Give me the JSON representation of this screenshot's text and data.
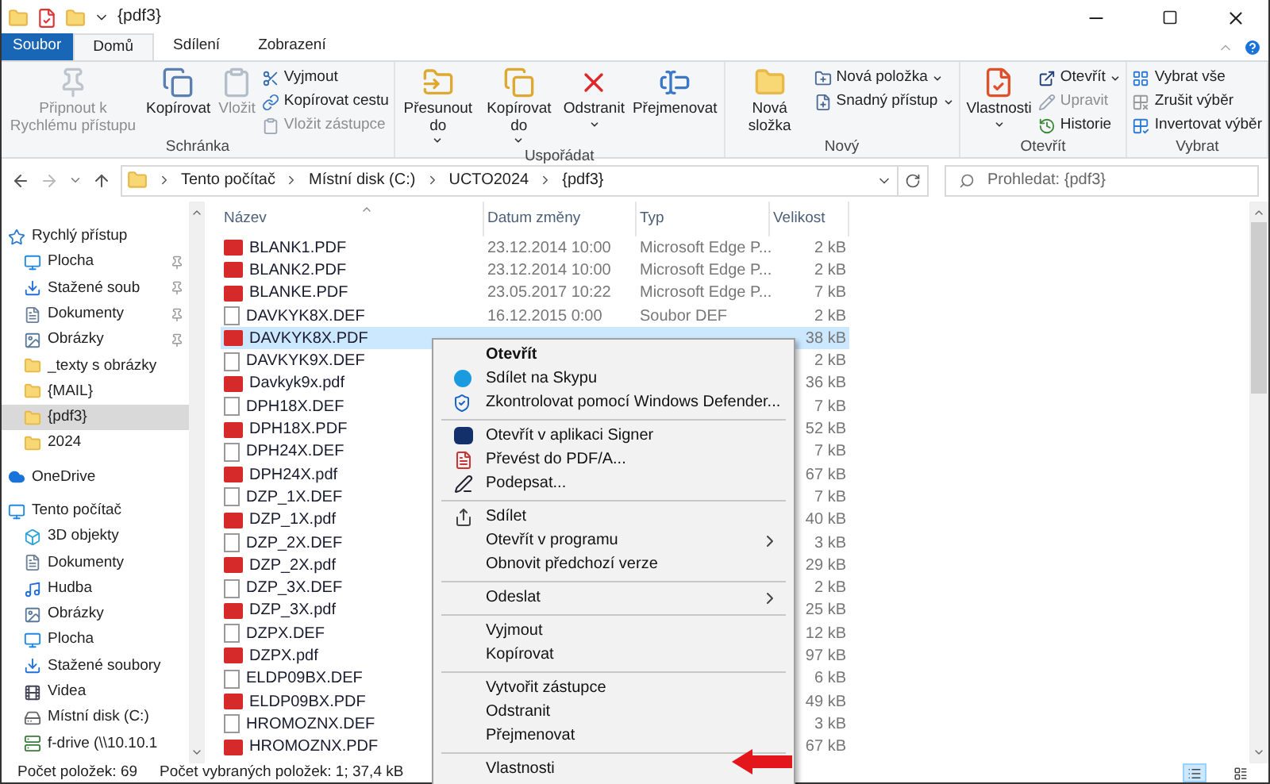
{
  "window": {
    "title": "{pdf3}"
  },
  "tabs": [
    {
      "label": "Soubor",
      "kind": "file",
      "selected": false
    },
    {
      "label": "Domů",
      "kind": "tab",
      "selected": true
    },
    {
      "label": "Sdílení",
      "kind": "tab",
      "selected": false
    },
    {
      "label": "Zobrazení",
      "kind": "tab",
      "selected": false
    }
  ],
  "ribbon": [
    {
      "label": "Schránka",
      "large": [
        {
          "label": "Připnout k Rychlému přístupu",
          "disabled": true,
          "dropdown": false
        },
        {
          "label": "Kopírovat",
          "disabled": false,
          "dropdown": false
        },
        {
          "label": "Vložit",
          "disabled": true,
          "dropdown": false
        }
      ],
      "small": [
        {
          "label": "Vyjmout",
          "disabled": false,
          "dropdown": false
        },
        {
          "label": "Kopírovat cestu",
          "disabled": false,
          "dropdown": false
        },
        {
          "label": "Vložit zástupce",
          "disabled": true,
          "dropdown": false
        }
      ]
    },
    {
      "label": "Uspořádat",
      "large": [
        {
          "label": "Přesunout do",
          "disabled": false,
          "dropdown": true
        },
        {
          "label": "Kopírovat do",
          "disabled": false,
          "dropdown": true
        },
        {
          "label": "Odstranit",
          "disabled": false,
          "dropdown": true
        },
        {
          "label": "Přejmenovat",
          "disabled": false,
          "dropdown": false
        }
      ]
    },
    {
      "label": "Nový",
      "large": [
        {
          "label": "Nová složka",
          "disabled": false,
          "dropdown": false
        }
      ],
      "small": [
        {
          "label": "Nová položka",
          "disabled": false,
          "dropdown": true
        },
        {
          "label": "Snadný přístup",
          "disabled": false,
          "dropdown": true
        }
      ]
    },
    {
      "label": "Otevřít",
      "large": [
        {
          "label": "Vlastnosti",
          "disabled": false,
          "dropdown": true
        }
      ],
      "small": [
        {
          "label": "Otevřít",
          "disabled": false,
          "dropdown": true
        },
        {
          "label": "Upravit",
          "disabled": true,
          "dropdown": false
        },
        {
          "label": "Historie",
          "disabled": false,
          "dropdown": false
        }
      ]
    },
    {
      "label": "Vybrat",
      "small": [
        {
          "label": "Vybrat vše",
          "disabled": false,
          "dropdown": false
        },
        {
          "label": "Zrušit výběr",
          "disabled": false,
          "dropdown": false
        },
        {
          "label": "Invertovat výběr",
          "disabled": false,
          "dropdown": false
        }
      ]
    }
  ],
  "address": {
    "path": [
      "Tento počítač",
      "Místní disk (C:)",
      "UCTO2024",
      "{pdf3}"
    ],
    "search_placeholder": "Prohledat: {pdf3}"
  },
  "sidebar": [
    {
      "label": "Rychlý přístup",
      "kind": "star",
      "selected": false,
      "children": [
        {
          "label": "Plocha",
          "kind": "desktop",
          "pinned": true,
          "selected": false
        },
        {
          "label": "Stažené soub",
          "kind": "download",
          "pinned": true,
          "selected": false
        },
        {
          "label": "Dokumenty",
          "kind": "docs",
          "pinned": true,
          "selected": false
        },
        {
          "label": "Obrázky",
          "kind": "pictures",
          "pinned": true,
          "selected": false
        },
        {
          "label": "_texty s obrázky",
          "kind": "folder",
          "pinned": false,
          "selected": false
        },
        {
          "label": "{MAIL}",
          "kind": "folder",
          "pinned": false,
          "selected": false
        },
        {
          "label": "{pdf3}",
          "kind": "folder",
          "pinned": false,
          "selected": true
        },
        {
          "label": "2024",
          "kind": "folder",
          "pinned": false,
          "selected": false
        }
      ]
    },
    {
      "label": "OneDrive",
      "kind": "cloud",
      "selected": false
    },
    {
      "label": "Tento počítač",
      "kind": "pc",
      "selected": false,
      "children": [
        {
          "label": "3D objekty",
          "kind": "cube",
          "pinned": false,
          "selected": false
        },
        {
          "label": "Dokumenty",
          "kind": "docs",
          "pinned": false,
          "selected": false
        },
        {
          "label": "Hudba",
          "kind": "music",
          "pinned": false,
          "selected": false
        },
        {
          "label": "Obrázky",
          "kind": "pictures",
          "pinned": false,
          "selected": false
        },
        {
          "label": "Plocha",
          "kind": "desktop",
          "pinned": false,
          "selected": false
        },
        {
          "label": "Stažené soubory",
          "kind": "download",
          "pinned": false,
          "selected": false
        },
        {
          "label": "Videa",
          "kind": "video",
          "pinned": false,
          "selected": false
        },
        {
          "label": "Místní disk (C:)",
          "kind": "disk",
          "pinned": false,
          "selected": false
        },
        {
          "label": "f-drive (\\\\10.10.1",
          "kind": "netdrive",
          "pinned": false,
          "selected": false
        }
      ]
    }
  ],
  "table": {
    "columns": [
      "Název",
      "Datum změny",
      "Typ",
      "Velikost"
    ],
    "rows": [
      {
        "name": "BLANK1.PDF",
        "kind": "pdf",
        "date": "23.12.2014 10:00",
        "type": "Microsoft Edge P...",
        "size": "2 kB",
        "selected": false
      },
      {
        "name": "BLANK2.PDF",
        "kind": "pdf",
        "date": "23.12.2014 10:00",
        "type": "Microsoft Edge P...",
        "size": "2 kB",
        "selected": false
      },
      {
        "name": "BLANKE.PDF",
        "kind": "pdf",
        "date": "23.05.2017 10:22",
        "type": "Microsoft Edge P...",
        "size": "7 kB",
        "selected": false
      },
      {
        "name": "DAVKYK8X.DEF",
        "kind": "def",
        "date": "16.12.2015 0:00",
        "type": "Soubor DEF",
        "size": "2 kB",
        "selected": false
      },
      {
        "name": "DAVKYK8X.PDF",
        "kind": "pdf",
        "size": "38 kB",
        "selected": true
      },
      {
        "name": "DAVKYK9X.DEF",
        "kind": "def",
        "size": "2 kB",
        "selected": false
      },
      {
        "name": "Davkyk9x.pdf",
        "kind": "pdf",
        "size": "36 kB",
        "selected": false
      },
      {
        "name": "DPH18X.DEF",
        "kind": "def",
        "size": "7 kB",
        "selected": false
      },
      {
        "name": "DPH18X.PDF",
        "kind": "pdf",
        "size": "52 kB",
        "selected": false
      },
      {
        "name": "DPH24X.DEF",
        "kind": "def",
        "size": "7 kB",
        "selected": false
      },
      {
        "name": "DPH24X.pdf",
        "kind": "pdf",
        "size": "67 kB",
        "selected": false
      },
      {
        "name": "DZP_1X.DEF",
        "kind": "def",
        "size": "7 kB",
        "selected": false
      },
      {
        "name": "DZP_1X.pdf",
        "kind": "pdf",
        "size": "40 kB",
        "selected": false
      },
      {
        "name": "DZP_2X.DEF",
        "kind": "def",
        "size": "3 kB",
        "selected": false
      },
      {
        "name": "DZP_2X.pdf",
        "kind": "pdf",
        "size": "29 kB",
        "selected": false
      },
      {
        "name": "DZP_3X.DEF",
        "kind": "def",
        "size": "2 kB",
        "selected": false
      },
      {
        "name": "DZP_3X.pdf",
        "kind": "pdf",
        "size": "25 kB",
        "selected": false
      },
      {
        "name": "DZPX.DEF",
        "kind": "def",
        "size": "12 kB",
        "selected": false
      },
      {
        "name": "DZPX.pdf",
        "kind": "pdf",
        "size": "97 kB",
        "selected": false
      },
      {
        "name": "ELDP09BX.DEF",
        "kind": "def",
        "size": "6 kB",
        "selected": false
      },
      {
        "name": "ELDP09BX.PDF",
        "kind": "pdf",
        "size": "49 kB",
        "selected": false
      },
      {
        "name": "HROMOZNX.DEF",
        "kind": "def",
        "size": "3 kB",
        "selected": false
      },
      {
        "name": "HROMOZNX.PDF",
        "kind": "pdf",
        "size": "67 kB",
        "selected": false
      }
    ]
  },
  "context_menu": [
    [
      {
        "label": "Otevřít",
        "bold": true,
        "submenu": false
      },
      {
        "label": "Sdílet na Skypu",
        "bold": false,
        "submenu": false
      },
      {
        "label": "Zkontrolovat pomocí Windows Defender...",
        "bold": false,
        "submenu": false
      }
    ],
    [
      {
        "label": "Otevřít v aplikaci Signer",
        "bold": false,
        "submenu": false
      },
      {
        "label": "Převést do PDF/A...",
        "bold": false,
        "submenu": false
      },
      {
        "label": "Podepsat...",
        "bold": false,
        "submenu": false
      }
    ],
    [
      {
        "label": "Sdílet",
        "bold": false,
        "submenu": false
      },
      {
        "label": "Otevřít v programu",
        "bold": false,
        "submenu": true
      },
      {
        "label": "Obnovit předchozí verze",
        "bold": false,
        "submenu": false
      }
    ],
    [
      {
        "label": "Odeslat",
        "bold": false,
        "submenu": true
      }
    ],
    [
      {
        "label": "Vyjmout",
        "bold": false,
        "submenu": false
      },
      {
        "label": "Kopírovat",
        "bold": false,
        "submenu": false
      }
    ],
    [
      {
        "label": "Vytvořit zástupce",
        "bold": false,
        "submenu": false
      },
      {
        "label": "Odstranit",
        "bold": false,
        "submenu": false
      },
      {
        "label": "Přejmenovat",
        "bold": false,
        "submenu": false
      }
    ],
    [
      {
        "label": "Vlastnosti",
        "bold": false,
        "submenu": false
      }
    ]
  ],
  "status_bar": {
    "items_count": "Počet položek: 69",
    "selection": "Počet vybraných položek: 1; 37,4 kB",
    "views": [
      {
        "kind": "details",
        "selected": true
      },
      {
        "kind": "tiles",
        "selected": false
      }
    ]
  }
}
